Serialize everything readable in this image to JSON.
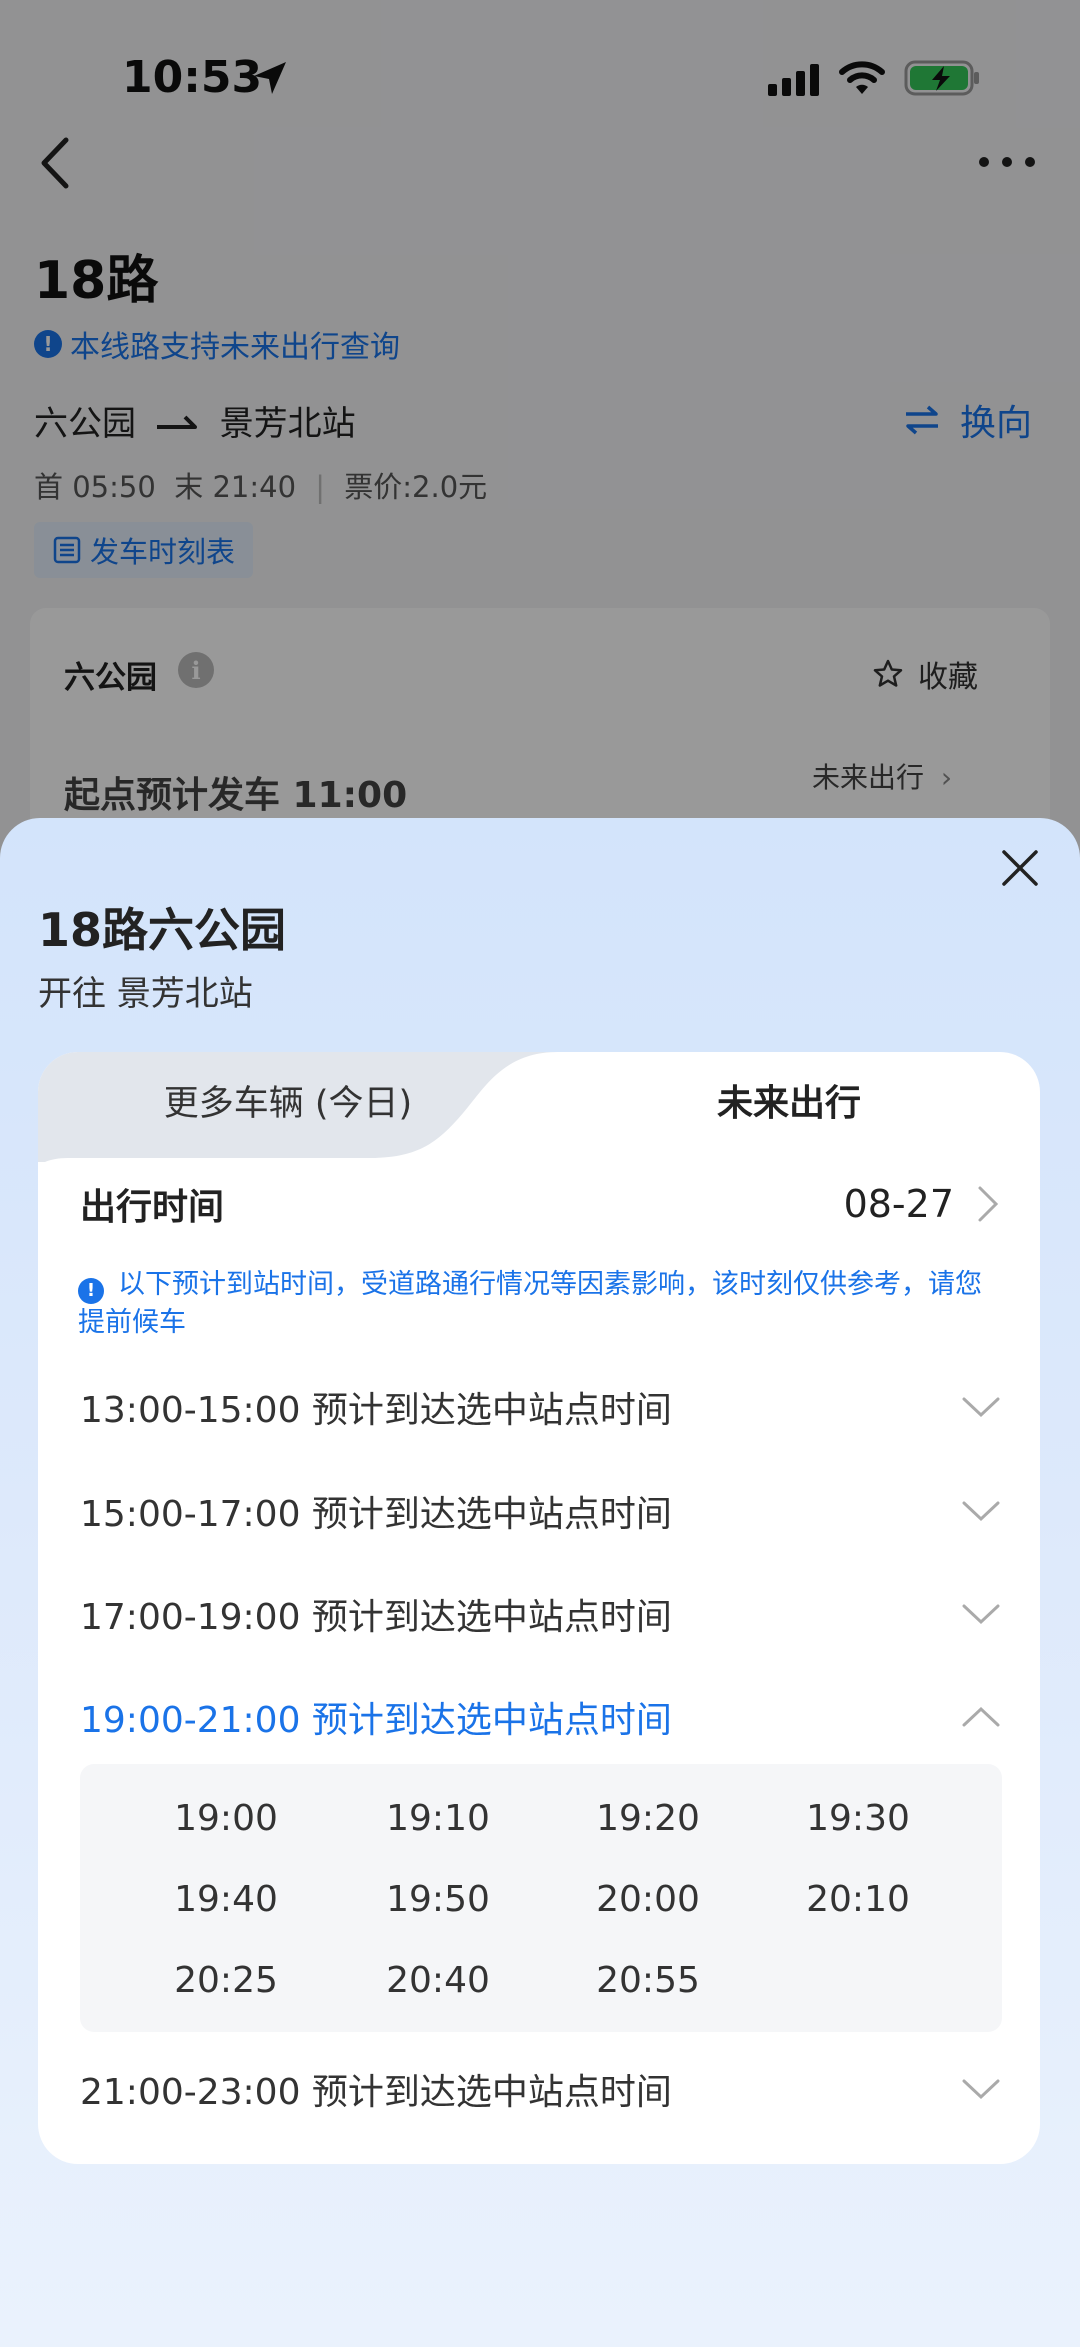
{
  "status_bar": {
    "time": "10:53"
  },
  "route": {
    "title": "18路",
    "notice": "本线路支持未来出行查询",
    "from": "六公园",
    "to": "景芳北站",
    "switch_label": "换向",
    "first_label": "首",
    "first_time": "05:50",
    "last_label": "末",
    "last_time": "21:40",
    "fare": "票价:2.0元",
    "schedule_button": "发车时刻表"
  },
  "stop_card": {
    "stop_name": "六公园",
    "favorite_label": "收藏",
    "departure_text": "起点预计发车 11:00",
    "future_link": "未来出行"
  },
  "sheet": {
    "title": "18路六公园",
    "subtitle": "开往 景芳北站",
    "tabs": [
      {
        "label": "更多车辆 (今日)",
        "active": false
      },
      {
        "label": "未来出行",
        "active": true
      }
    ],
    "date_row": {
      "label": "出行时间",
      "value": "08-27"
    },
    "tip": "以下预计到站时间，受道路通行情况等因素影响，该时刻仅供参考，请您提前候车",
    "slots": [
      {
        "label": "13:00-15:00 预计到达选中站点时间",
        "expanded": false
      },
      {
        "label": "15:00-17:00 预计到达选中站点时间",
        "expanded": false
      },
      {
        "label": "17:00-19:00 预计到达选中站点时间",
        "expanded": false
      },
      {
        "label": "19:00-21:00 预计到达选中站点时间",
        "expanded": true
      },
      {
        "label": "21:00-23:00 预计到达选中站点时间",
        "expanded": false
      }
    ],
    "expanded_times": [
      "19:00",
      "19:10",
      "19:20",
      "19:30",
      "19:40",
      "19:50",
      "20:00",
      "20:10",
      "20:25",
      "20:40",
      "20:55"
    ]
  },
  "colors": {
    "accent": "#1a73e8",
    "overlay": "rgba(0,0,0,0.40)",
    "sheet_top": "#d3e4fb",
    "inactive_tab": "#e2e6ec"
  }
}
